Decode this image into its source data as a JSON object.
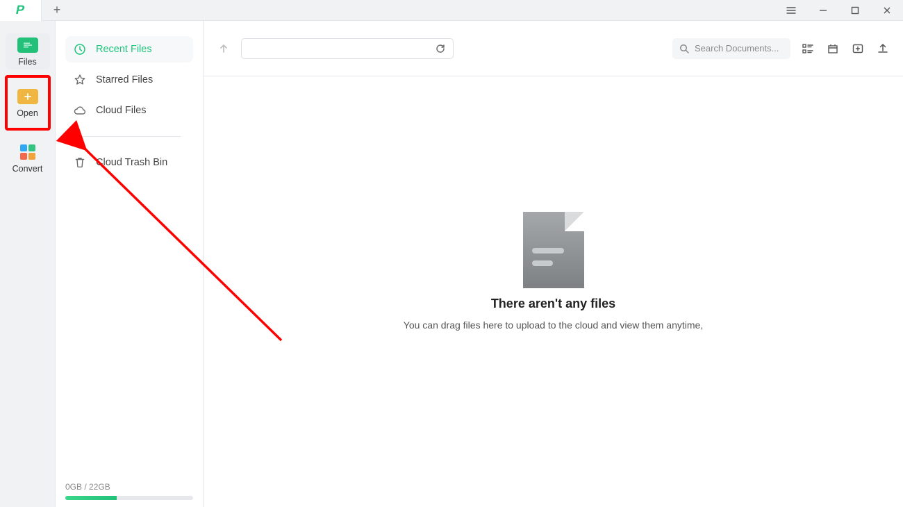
{
  "leftrail": {
    "files": "Files",
    "open": "Open",
    "convert": "Convert"
  },
  "categories": {
    "recent": "Recent Files",
    "starred": "Starred Files",
    "cloud": "Cloud Files",
    "trash": "Cloud Trash Bin"
  },
  "storage": {
    "label": "0GB / 22GB",
    "used_pct": 40
  },
  "toolbar": {
    "search_placeholder": "Search Documents..."
  },
  "empty_state": {
    "title": "There aren't any files",
    "subtitle": "You can drag files here to upload to the cloud and view them anytime,"
  },
  "colors": {
    "accent": "#1fc57c",
    "highlight": "#ff0000"
  }
}
